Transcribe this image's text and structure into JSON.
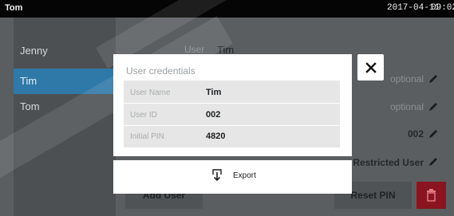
{
  "topbar": {
    "user": "Tom",
    "date": "2017-04-11",
    "time": "09:02"
  },
  "background": {
    "users": [
      "Jenny",
      "Tim",
      "Tom"
    ],
    "header_label": "User",
    "header_value": "Tim",
    "fields": [
      "optional",
      "optional",
      "002",
      "Restricted User"
    ],
    "add_user_label": "Add User",
    "reset_pin_label": "Reset PIN"
  },
  "modal": {
    "title": "User credentials",
    "rows": [
      {
        "label": "User Name",
        "value": "Tim"
      },
      {
        "label": "User ID",
        "value": "002"
      },
      {
        "label": "Initial PIN",
        "value": "4820"
      }
    ],
    "export_label": "Export"
  }
}
